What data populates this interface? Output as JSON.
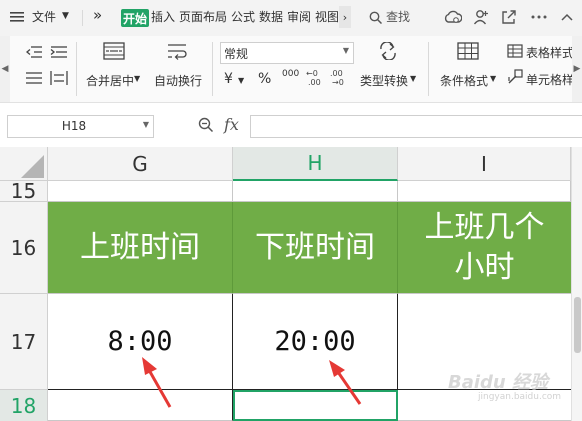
{
  "menubar": {
    "file": "文件",
    "more": "»",
    "tabs": [
      "开始",
      "插入",
      "页面布局",
      "公式",
      "数据",
      "审阅",
      "视图"
    ],
    "search": "查找"
  },
  "ribbon": {
    "merge_center": "合并居中",
    "auto_wrap": "自动换行",
    "number_format": "常规",
    "currency_symbol": "¥",
    "percent_symbol": "%",
    "thousands_symbol": "000",
    "type_convert": "类型转换",
    "conditional_format": "条件格式",
    "table_style": "表格样式",
    "cell_style": "单元格样"
  },
  "formula_bar": {
    "name_box": "H18",
    "fx": "fx",
    "content": ""
  },
  "grid": {
    "columns": [
      "G",
      "H",
      "I"
    ],
    "rows": [
      "15",
      "16",
      "17",
      "18"
    ],
    "row16": [
      "上班时间",
      "下班时间",
      "上班几个\n小时"
    ],
    "row17": [
      "8:00",
      "20:00",
      ""
    ]
  },
  "watermark": {
    "brand": "Baidu 经验",
    "url": "jingyan.baidu.com"
  },
  "colors": {
    "accent": "#21a366",
    "header_fill": "#70ad47",
    "arrow": "#e53935"
  }
}
